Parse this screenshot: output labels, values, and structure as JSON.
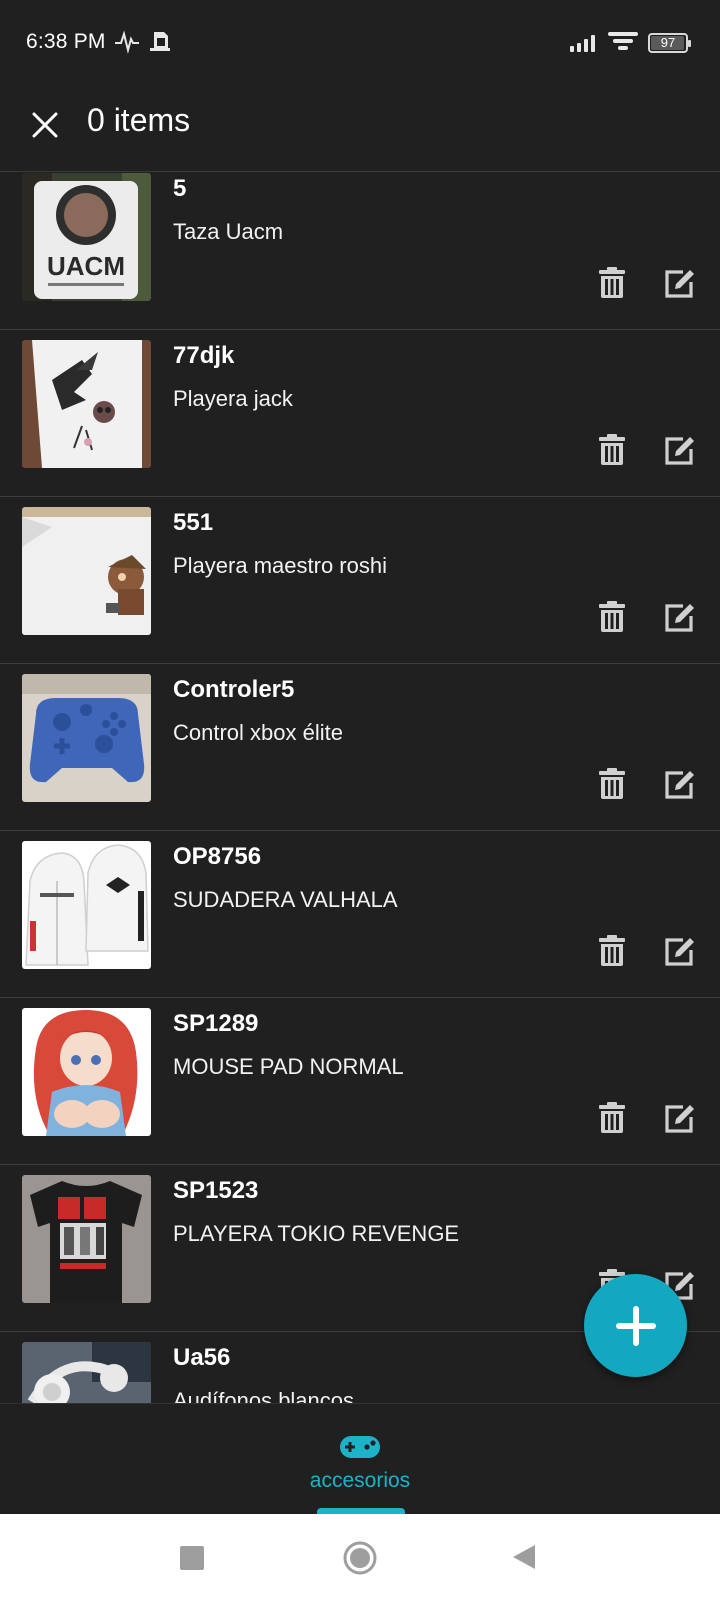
{
  "status_bar": {
    "time": "6:38 PM",
    "battery_level": "97",
    "icons": [
      "pulse-icon",
      "sim-icon",
      "signal-icon",
      "wifi-icon",
      "battery-icon"
    ]
  },
  "app_bar": {
    "title": "0 items",
    "close_icon": "close-icon"
  },
  "items": [
    {
      "code": "5",
      "name": "Taza Uacm",
      "image": "mug-photo"
    },
    {
      "code": "77djk",
      "name": "Playera jack",
      "image": "shirt-jack-photo"
    },
    {
      "code": "551",
      "name": "Playera maestro roshi",
      "image": "shirt-roshi-photo"
    },
    {
      "code": "Controler5",
      "name": "Control xbox élite",
      "image": "controller-photo"
    },
    {
      "code": "OP8756",
      "name": "SUDADERA VALHALA",
      "image": "hoodie-photo"
    },
    {
      "code": "SP1289",
      "name": "MOUSE PAD NORMAL",
      "image": "mousepad-photo"
    },
    {
      "code": "SP1523",
      "name": "PLAYERA TOKIO REVENGE",
      "image": "black-shirt-photo"
    },
    {
      "code": "Ua56",
      "name": "Audífonos blancos",
      "image": "headphones-photo"
    }
  ],
  "item_actions": {
    "delete_icon": "trash-icon",
    "edit_icon": "edit-icon"
  },
  "fab": {
    "icon": "plus-icon"
  },
  "bottom_nav": {
    "items": [
      {
        "label": "accesorios",
        "icon": "gamepad-icon",
        "active": true
      }
    ]
  },
  "colors": {
    "background": "#202020",
    "accent": "#13a8bf",
    "icon_grey": "#d0d0d0",
    "divider": "#3d3d3d"
  }
}
